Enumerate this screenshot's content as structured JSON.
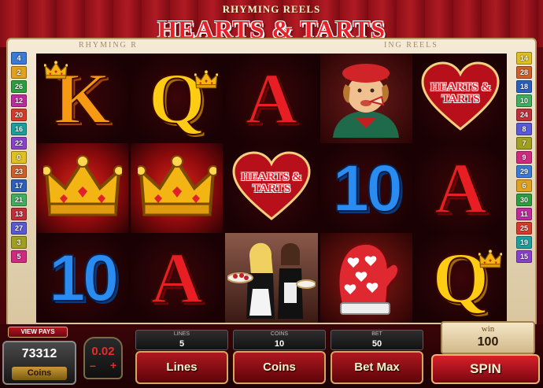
{
  "title": {
    "subtitle": "RHYMING REELS",
    "main": "HEARTS & TARTS"
  },
  "frame_band": {
    "left": "RHYMING R",
    "right": "ING REELS"
  },
  "paylines": {
    "left": [
      "4",
      "2",
      "26",
      "12",
      "20",
      "16",
      "22",
      "0",
      "23",
      "17",
      "21",
      "13",
      "27",
      "3",
      "5"
    ],
    "right": [
      "14",
      "28",
      "18",
      "10",
      "24",
      "8",
      "7",
      "9",
      "29",
      "6",
      "30",
      "11",
      "25",
      "19",
      "15"
    ]
  },
  "reels": [
    [
      {
        "sym": "K",
        "icon": "crown-icon"
      },
      {
        "sym": "crown"
      },
      {
        "sym": "10"
      }
    ],
    [
      {
        "sym": "Q",
        "icon": "crown-icon"
      },
      {
        "sym": "crown"
      },
      {
        "sym": "A"
      }
    ],
    [
      {
        "sym": "A"
      },
      {
        "sym": "logo",
        "text": "HEARTS & TARTS"
      },
      {
        "sym": "maids"
      }
    ],
    [
      {
        "sym": "knave"
      },
      {
        "sym": "10"
      },
      {
        "sym": "mitt"
      }
    ],
    [
      {
        "sym": "logo",
        "text": "HEARTS & TARTS"
      },
      {
        "sym": "A"
      },
      {
        "sym": "Q",
        "icon": "crown-icon"
      }
    ]
  ],
  "console": {
    "view_pays": "VIEW PAYS",
    "coins_value": "73312",
    "coins_label": "Coins",
    "coin_size": "0.02",
    "coin_minus": "–",
    "coin_plus": "+",
    "lines_meter": {
      "label": "LINES",
      "value": "5"
    },
    "coins_meter": {
      "label": "COINS",
      "value": "10"
    },
    "bet_meter": {
      "label": "BET",
      "value": "50"
    },
    "lines_btn": "Lines",
    "coins_btn": "Coins",
    "betmax_btn": "Bet Max",
    "win_label": "win",
    "win_value": "100",
    "spin_btn": "SPIN"
  },
  "colors": {
    "background": "#8a0a12",
    "accent_gold": "#d0a860",
    "spin_red": "#d8202a"
  }
}
